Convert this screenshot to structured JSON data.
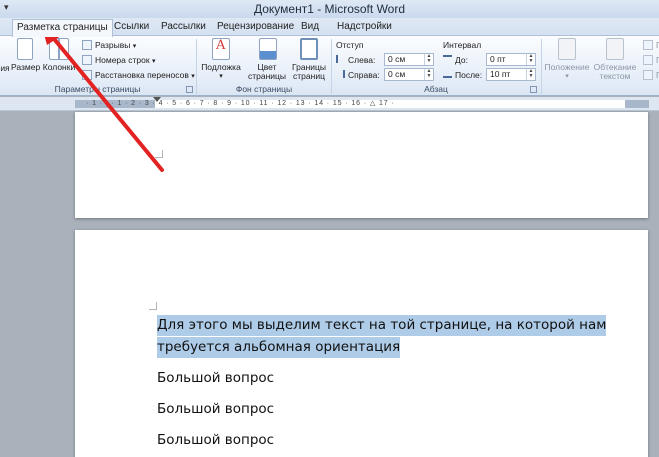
{
  "window": {
    "title": "Документ1 - Microsoft Word",
    "qat_glyph": "▾"
  },
  "tabs": [
    {
      "label": "Разметка страницы",
      "active": true
    },
    {
      "label": "Ссылки",
      "active": false
    },
    {
      "label": "Рассылки",
      "active": false
    },
    {
      "label": "Рецензирование",
      "active": false
    },
    {
      "label": "Вид",
      "active": false
    },
    {
      "label": "Надстройки",
      "active": false
    }
  ],
  "ribbon": {
    "page_setup": {
      "label": "Параметры страницы",
      "orientation_partial": "ия",
      "size": "Размер",
      "columns": "Колонки",
      "breaks": "Разрывы",
      "line_numbers": "Номера строк",
      "hyphenation": "Расстановка переносов",
      "dropdown_glyph": "▾"
    },
    "page_background": {
      "label": "Фон страницы",
      "watermark": "Подложка",
      "page_color": "Цвет страницы",
      "page_borders": "Границы страниц"
    },
    "paragraph": {
      "label": "Абзац",
      "indent_header": "Отступ",
      "spacing_header": "Интервал",
      "left_label": "Слева:",
      "left_value": "0 см",
      "right_label": "Справа:",
      "right_value": "0 см",
      "before_label": "До:",
      "before_value": "0 пт",
      "after_label": "После:",
      "after_value": "10 пт"
    },
    "arrange": {
      "position": "Положение",
      "wrap_text": "Обтекание текстом",
      "cut_1": "П",
      "cut_2": "Г",
      "cut_3": "Г"
    }
  },
  "ruler": {
    "numbers": "· 1 · | · 1 · 2 · 3 · 4 · 5 · 6 · 7 · 8 · 9 · 10 · 11 · 12 · 13 · 14 · 15 · 16 · △ 17 ·"
  },
  "document": {
    "selected_line_1": "Для этого мы выделим текст на той странице, на которой нам",
    "selected_line_2": "требуется альбомная ориентация",
    "paragraphs": [
      "Большой вопрос",
      "Большой вопрос",
      "Большой вопрос"
    ]
  },
  "annotation": {
    "arrow_color": "#e32222"
  }
}
